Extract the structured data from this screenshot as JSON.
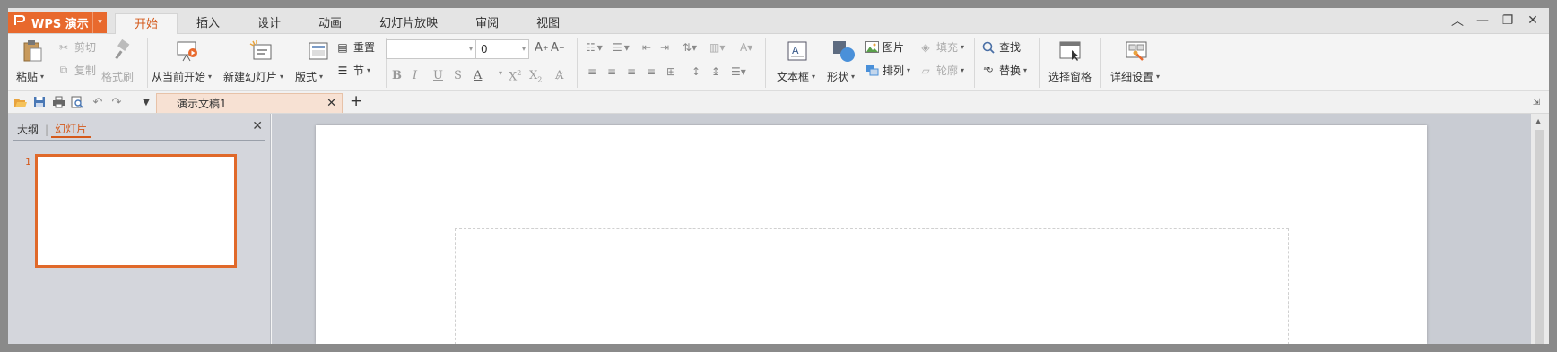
{
  "app": {
    "logo_text": "WPS 演示",
    "brand_color": "#e8692d"
  },
  "menu_tabs": [
    {
      "label": "开始",
      "active": true
    },
    {
      "label": "插入",
      "active": false
    },
    {
      "label": "设计",
      "active": false
    },
    {
      "label": "动画",
      "active": false
    },
    {
      "label": "幻灯片放映",
      "active": false
    },
    {
      "label": "审阅",
      "active": false
    },
    {
      "label": "视图",
      "active": false
    }
  ],
  "ribbon": {
    "paste": "粘贴",
    "cut": "剪切",
    "copy": "复制",
    "format_painter": "格式刷",
    "from_current": "从当前开始",
    "new_slide": "新建幻灯片",
    "layout": "版式",
    "reset": "重置",
    "section": "节",
    "font_name": "",
    "font_size": "0",
    "text_box": "文本框",
    "shape": "形状",
    "picture": "图片",
    "arrange": "排列",
    "fill": "填充",
    "outline": "轮廓",
    "find": "查找",
    "replace": "替换",
    "selection_pane": "选择窗格",
    "detail_settings": "详细设置"
  },
  "document": {
    "tab_title": "演示文稿1"
  },
  "left_pane": {
    "tab_outline": "大纲",
    "tab_slides": "幻灯片",
    "slide_number": "1"
  }
}
